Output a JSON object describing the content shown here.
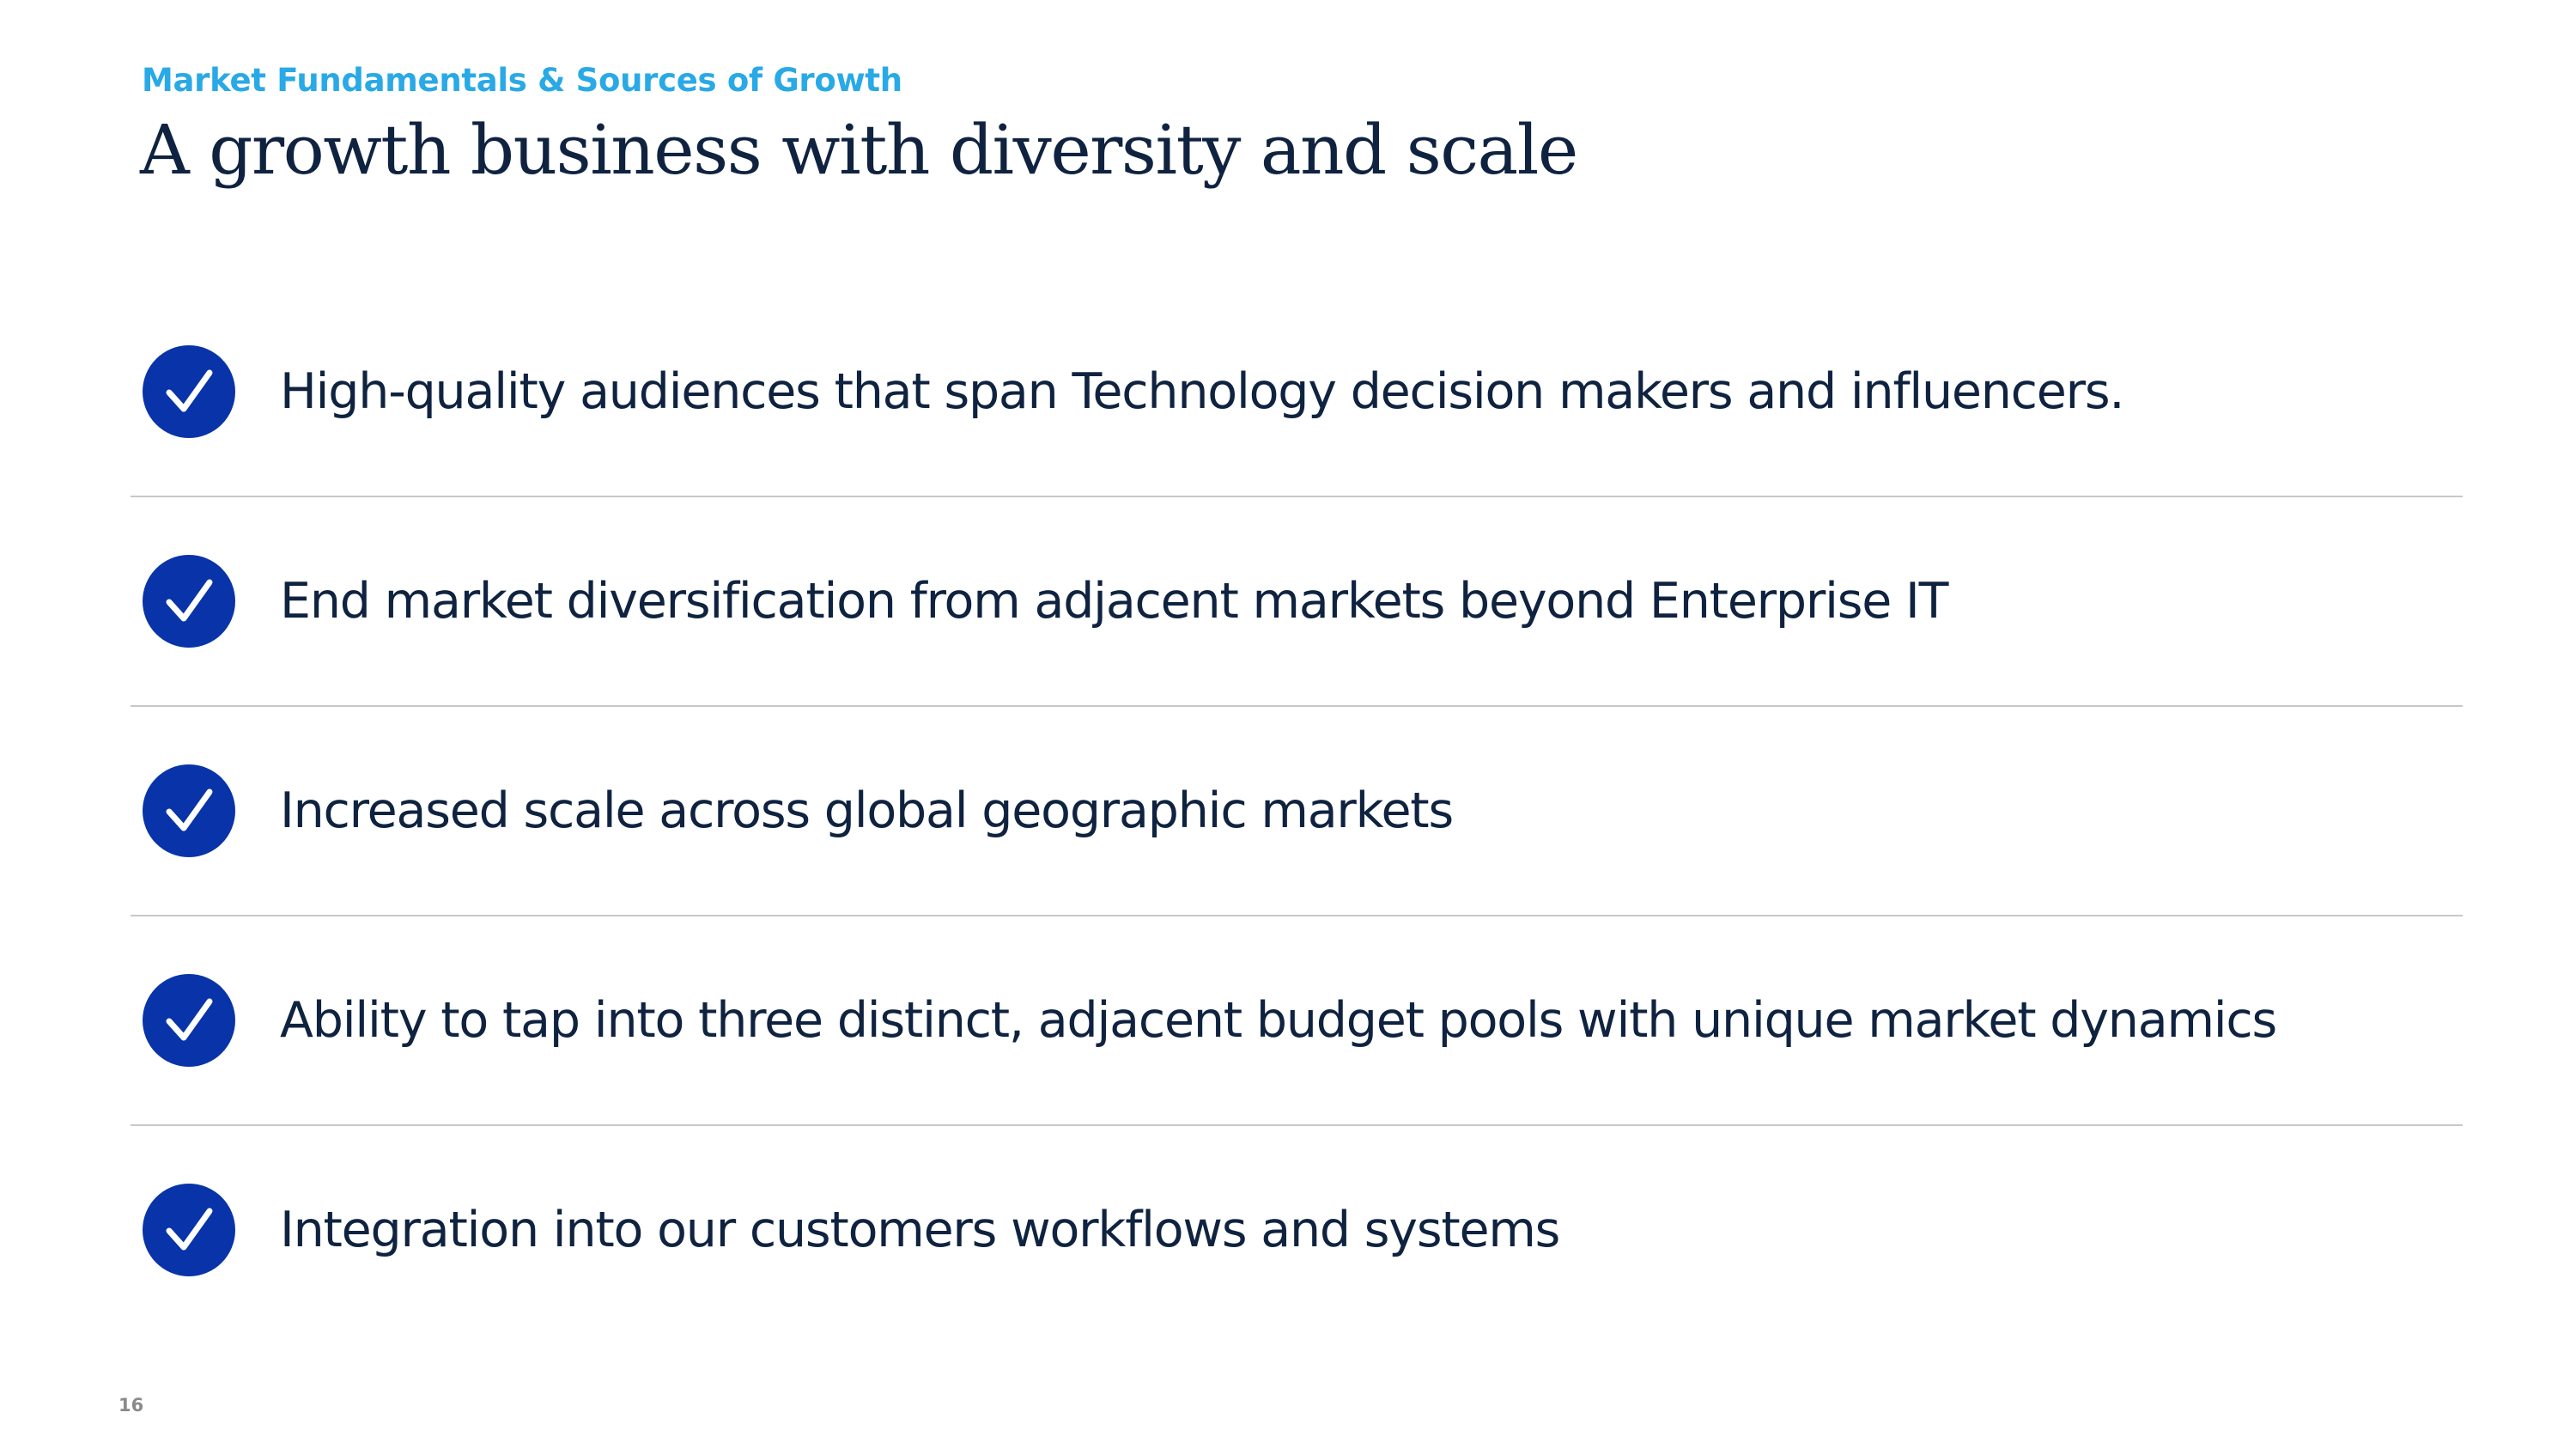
{
  "header": {
    "eyebrow": "Market Fundamentals & Sources of Growth",
    "title": "A growth business with diversity and scale"
  },
  "bullets": [
    {
      "icon": "check-circle-icon",
      "text": "High-quality audiences that span Technology decision makers and influencers."
    },
    {
      "icon": "check-circle-icon",
      "text": "End market diversification from adjacent markets beyond Enterprise IT"
    },
    {
      "icon": "check-circle-icon",
      "text": "Increased scale across global geographic markets"
    },
    {
      "icon": "check-circle-icon",
      "text": "Ability to tap into three distinct, adjacent budget pools with unique market dynamics"
    },
    {
      "icon": "check-circle-icon",
      "text": "Integration into our customers workflows and systems"
    }
  ],
  "footer": {
    "page_number": "16"
  },
  "colors": {
    "eyebrow": "#29a9e6",
    "title": "#0f2340",
    "check_fill": "#0833a9",
    "divider": "#c8c8c8"
  }
}
